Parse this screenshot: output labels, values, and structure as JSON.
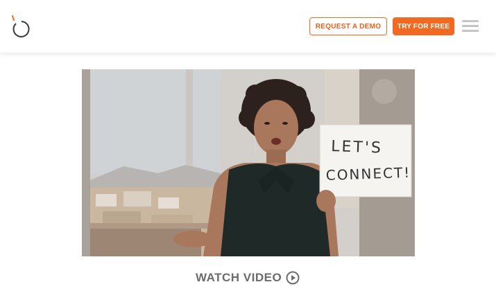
{
  "header": {
    "logo_icon": "refresh-circle-logo-icon",
    "request_demo_label": "REQUEST A DEMO",
    "try_free_label": "TRY FOR FREE",
    "menu_icon": "hamburger-menu-icon"
  },
  "video": {
    "sign_line1": "LET'S",
    "sign_line2": "CONNECT!",
    "watch_label": "WATCH VIDEO",
    "play_icon": "play-circle-icon"
  },
  "colors": {
    "accent": "#f26a21",
    "watch_text": "#6b6b6b"
  }
}
